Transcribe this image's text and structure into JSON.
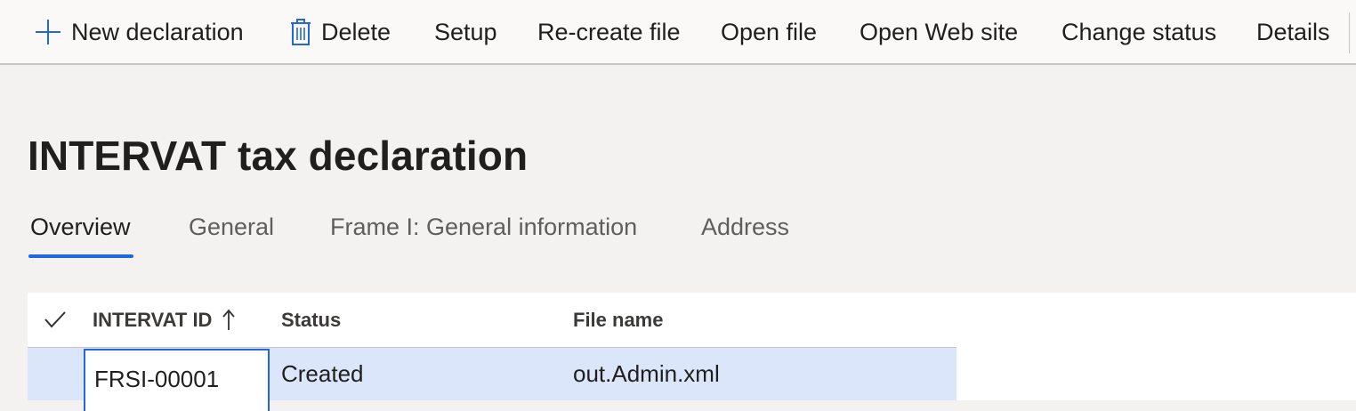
{
  "action_pane": {
    "new_declaration": "New declaration",
    "delete": "Delete",
    "setup": "Setup",
    "recreate_file": "Re-create file",
    "open_file": "Open file",
    "open_web_site": "Open Web site",
    "change_status": "Change status",
    "details": "Details",
    "icons": {
      "new": "plus-icon",
      "delete": "trash-icon"
    },
    "accent_color": "#2266e3"
  },
  "page": {
    "title": "INTERVAT tax declaration"
  },
  "tabs": [
    {
      "label": "Overview",
      "active": true
    },
    {
      "label": "General",
      "active": false
    },
    {
      "label": "Frame I: General information",
      "active": false
    },
    {
      "label": "Address",
      "active": false
    }
  ],
  "grid": {
    "columns": [
      {
        "label": "INTERVAT ID",
        "sort": "ascending"
      },
      {
        "label": "Status"
      },
      {
        "label": "File name"
      }
    ],
    "rows": [
      {
        "intervat_id": "FRSI-00001",
        "status": "Created",
        "file_name": "out.Admin.xml",
        "selected": true
      }
    ],
    "selected_row_color": "#dbe6fb"
  }
}
